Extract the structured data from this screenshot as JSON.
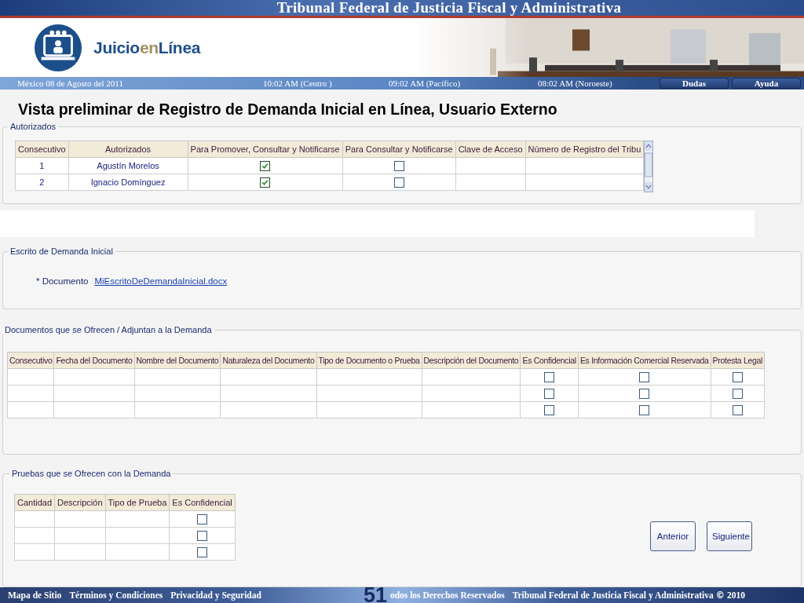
{
  "header": {
    "title": "Tribunal Federal de Justicia Fiscal y Administrativa",
    "logo_parts": [
      "Juicio",
      "en",
      "Línea"
    ]
  },
  "date_bar": {
    "date": "México 08 de Agosto del 2011",
    "times": [
      "10:02  AM (Centro )",
      "09:02 AM  (Pacífico)",
      "08:02 AM (Noroeste)"
    ],
    "buttons": [
      "Dudas",
      "Ayuda"
    ]
  },
  "heading": "Vista preliminar de Registro de Demanda Inicial en Línea, Usuario Externo",
  "autorizados": {
    "legend": "Autorizados",
    "columns": [
      "Consecutivo",
      "Autorizados",
      "Para Promover, Consultar y Notificarse",
      "Para Consultar y Notificarse",
      "Clave de Acceso",
      "Número de Registro del Tribu"
    ],
    "rows": [
      {
        "consecutivo": "1",
        "nombre": "Agustín Morelos",
        "promover": true,
        "consultar": false
      },
      {
        "consecutivo": "2",
        "nombre": "Ignacio Domínguez",
        "promover": true,
        "consultar": false
      }
    ]
  },
  "escrito": {
    "legend": "Escrito de Demanda Inicial",
    "label": "* Documento",
    "file": "MiEscritoDeDemandaInicial.docx"
  },
  "documentos": {
    "legend": "Documentos que se Ofrecen / Adjuntan a la Demanda",
    "columns": [
      "Consecutivo",
      "Fecha del Documento",
      "Nombre del Documento",
      "Naturaleza del Documento",
      "Tipo de Documento o Prueba",
      "Descripción del Documento",
      "Es Confidencial",
      "Es Información Comercial Reservada",
      "Protesta Legal"
    ],
    "rows": [
      {
        "confidencial": false,
        "comercial": false,
        "protesta": false
      },
      {
        "confidencial": false,
        "comercial": false,
        "protesta": false
      },
      {
        "confidencial": false,
        "comercial": false,
        "protesta": false
      }
    ]
  },
  "pruebas": {
    "legend": "Pruebas que se Ofrecen con la Demanda",
    "columns": [
      "Cantidad",
      "Descripción",
      "Tipo de Prueba",
      "Es Confidencial"
    ],
    "rows": [
      {
        "confidencial": false
      },
      {
        "confidencial": false
      },
      {
        "confidencial": false
      }
    ]
  },
  "nav_buttons": [
    "Anterior",
    "Siguiente"
  ],
  "footer": {
    "links": [
      "Mapa de Sitio",
      "Términos y Condiciones",
      "Privacidad y Seguridad"
    ],
    "slide_number": "51",
    "rights": "odos los Derechos Reservados",
    "org": "Tribunal Federal de Justicia Fiscal y Administrativa",
    "copyright": "©",
    "year": "2010"
  }
}
